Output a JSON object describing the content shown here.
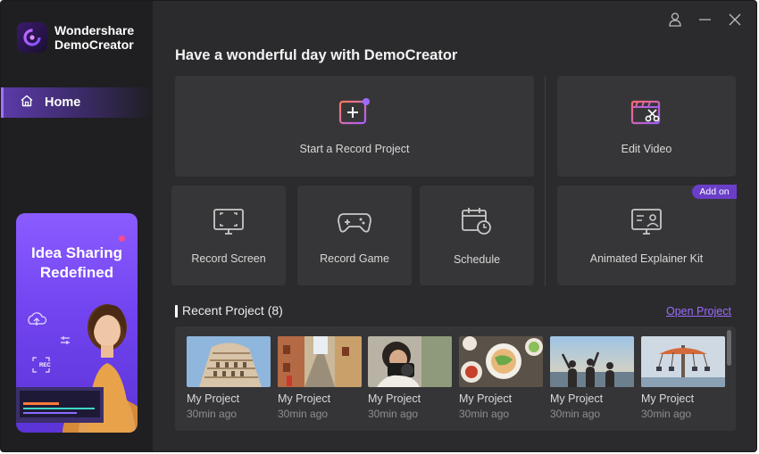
{
  "app": {
    "name_line1": "Wondershare",
    "name_line2": "DemoCreator"
  },
  "sidebar": {
    "home_label": "Home"
  },
  "promo": {
    "title_line1": "Idea Sharing",
    "title_line2": "Redefined",
    "rec_label": "REC"
  },
  "main": {
    "greeting": "Have a wonderful day with DemoCreator",
    "cards": {
      "start_record": "Start a Record Project",
      "edit_video": "Edit Video",
      "record_screen": "Record Screen",
      "record_game": "Record Game",
      "schedule": "Schedule",
      "animated_kit": "Animated Explainer Kit"
    },
    "addon_badge": "Add on"
  },
  "recent": {
    "title": "Recent Project (8)",
    "open_link": "Open Project",
    "projects": [
      {
        "name": "My Project",
        "time": "30min ago"
      },
      {
        "name": "My Project",
        "time": "30min ago"
      },
      {
        "name": "My Project",
        "time": "30min ago"
      },
      {
        "name": "My Project",
        "time": "30min ago"
      },
      {
        "name": "My Project",
        "time": "30min ago"
      },
      {
        "name": "My Project",
        "time": "30min ago"
      }
    ]
  },
  "colors": {
    "accent": "#9b6cff",
    "window_bg": "#2b2b2d",
    "sidebar_bg": "#1f1f21",
    "card_bg": "#363638"
  },
  "icons": [
    "user-icon",
    "minimize-icon",
    "close-icon",
    "home-icon",
    "add-record-icon",
    "edit-video-icon",
    "record-screen-icon",
    "gamepad-icon",
    "schedule-icon",
    "explainer-kit-icon"
  ]
}
